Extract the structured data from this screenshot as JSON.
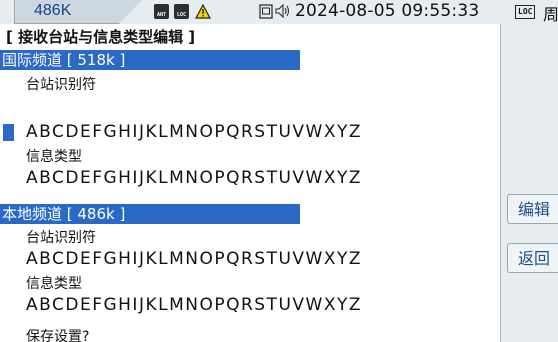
{
  "status": {
    "frequency": "486K",
    "datetime": "2024-08-05 09:55:33",
    "loc_badge": "LOC",
    "right_glyph": "周"
  },
  "icons": [
    "ant-icon",
    "loc-icon",
    "warning-icon",
    "sim-card-icon",
    "speaker-icon"
  ],
  "page": {
    "title": "[ 接收台站与信息类型编辑 ]",
    "sections": [
      {
        "header": "国际频道 [ 518k ]",
        "station_label": "台站识别符",
        "station_value": "ABCDEFGHIJKLMNOPQRSTUVWXYZ",
        "msgtype_label": "信息类型",
        "msgtype_value": "ABCDEFGHIJKLMNOPQRSTUVWXYZ"
      },
      {
        "header": "本地频道 [ 486k ]",
        "station_label": "台站识别符",
        "station_value": "ABCDEFGHIJKLMNOPQRSTUVWXYZ",
        "msgtype_label": "信息类型",
        "msgtype_value": "ABCDEFGHIJKLMNOPQRSTUVWXYZ"
      }
    ],
    "save_prompt": "保存设置?"
  },
  "side_buttons": {
    "edit": "编辑",
    "back": "返回"
  },
  "colors": {
    "accent": "#2a69c6",
    "background": "#e7ecf0",
    "panel": "#ffffff"
  }
}
